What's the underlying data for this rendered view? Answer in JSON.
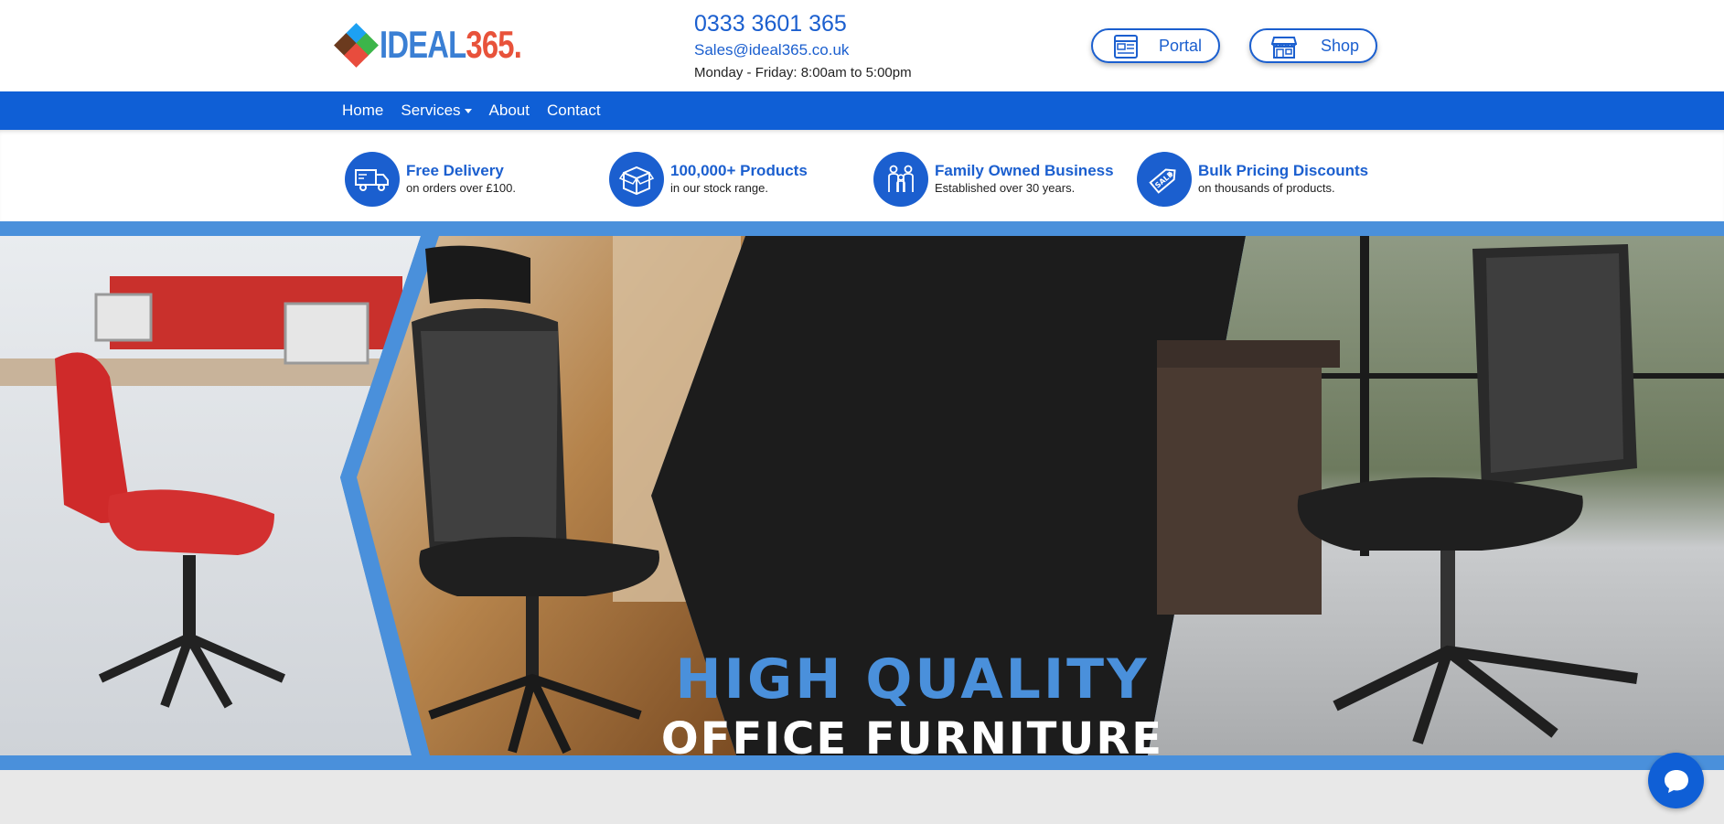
{
  "brand": {
    "name_part1": "IDEAL",
    "name_part2": "365."
  },
  "contact": {
    "phone": "0333 3601 365",
    "email": "Sales@ideal365.co.uk",
    "hours": "Monday - Friday: 8:00am to 5:00pm"
  },
  "header_buttons": {
    "portal_label": "Portal",
    "portal_icon": "portal-icon",
    "shop_label": "Shop",
    "shop_icon": "store-icon"
  },
  "nav": {
    "items": [
      {
        "label": "Home"
      },
      {
        "label": "Services"
      },
      {
        "label": "About"
      },
      {
        "label": "Contact"
      }
    ]
  },
  "features": [
    {
      "title": "Free Delivery",
      "subtitle": "on orders over £100.",
      "icon": "truck-icon"
    },
    {
      "title": "100,000+ Products",
      "subtitle": "in our stock range.",
      "icon": "box-icon"
    },
    {
      "title": "Family Owned Business",
      "subtitle": "Established over 30 years.",
      "icon": "family-icon"
    },
    {
      "title": "Bulk Pricing Discounts",
      "subtitle": "on thousands of products.",
      "icon": "sale-tag-icon"
    }
  ],
  "hero": {
    "title": "HIGH QUALITY",
    "subtitle": "OFFICE FURNITURE"
  },
  "chat": {
    "icon": "chat-bubble-icon"
  },
  "colors": {
    "primary": "#0f5fd6",
    "accent_blue": "#4a90db",
    "logo_red": "#e8523a",
    "hero_dark": "#1c1c1c"
  }
}
